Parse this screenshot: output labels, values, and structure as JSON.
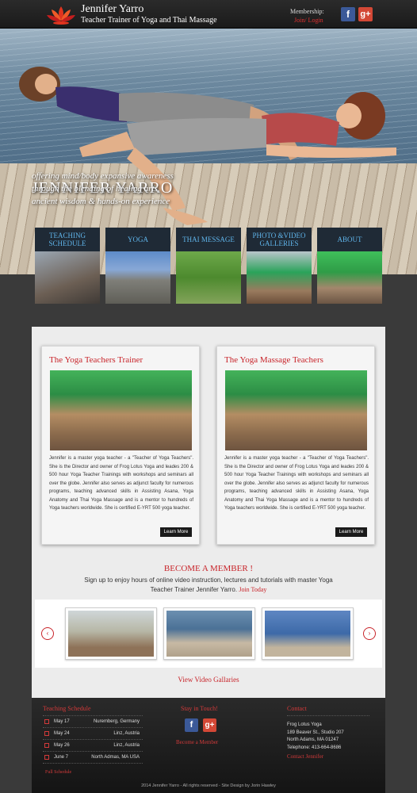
{
  "header": {
    "site_name": "Jennifer Yarro",
    "tagline": "Teacher Trainer  of Yoga and Thai Massage",
    "membership_label": "Membership:",
    "join_login": "Join/ Login",
    "social": {
      "facebook": "f",
      "google_plus": "g+"
    }
  },
  "hero": {
    "name": "JENNIFER YARRO",
    "lines": [
      "offering mind/body expansive awareness",
      "through the blending of healing arts,",
      "ancient wisdom & hands-on experience"
    ]
  },
  "nav": [
    {
      "label": "TEACHING SCHEDULE"
    },
    {
      "label": "YOGA"
    },
    {
      "label": "THAI MESSAGE"
    },
    {
      "label": "PHOTO &VIDEO GALLERIES"
    },
    {
      "label": "ABOUT"
    }
  ],
  "cards": [
    {
      "title": "The Yoga Teachers Trainer",
      "text": "Jennifer is a master yoga teacher - a \"Teacher of Yoga Teachers\". She is the Director and owner of Frog Lotus Yoga and leades 200 & 500 hour Yoga Teacher Trainings with workshops and seminars all over the globe. Jennifer also serves as adjunct faculty for numerous programs, teaching advanced skills in Assisting Asana, Yoga Anatomy and Thai Yoga Massage and is a mentor to hundreds of Yoga teachers worldwide. She is certified E-YRT 500 yoga teacher.",
      "button": "Learn More"
    },
    {
      "title": "The Yoga Massage Teachers",
      "text": "Jennifer is a master yoga teacher - a \"Teacher of Yoga Teachers\". She is the Director and owner of Frog Lotus Yoga and leades 200 & 500 hour Yoga Teacher Trainings with workshops and seminars all over the globe. Jennifer also serves as adjunct faculty for numerous programs, teaching advanced skills in Assisting Asana, Yoga Anatomy and Thai Yoga Massage and is a mentor to hundreds of Yoga teachers worldwide. She is certified E-YRT 500 yoga teacher.",
      "button": "Learn More"
    }
  ],
  "member": {
    "title": "BECOME A MEMBER !",
    "text": "Sign up to enjoy hours of online video instruction, lectures and tutorials with master Yoga Teacher Trainer Jennifer Yarro.",
    "join_today": "Join Today"
  },
  "carousel": {
    "prev_icon": "‹",
    "next_icon": "›"
  },
  "video_galleries": "View Video Gallaries",
  "footer": {
    "schedule_title": "Teaching Schedule",
    "schedule": [
      {
        "date": "May 17",
        "location": "Nuremberg, Germany"
      },
      {
        "date": "May 24",
        "location": "Linz, Austria"
      },
      {
        "date": "May 26",
        "location": "Linz, Austria"
      },
      {
        "date": "June 7",
        "location": "North Admas, MA USA"
      }
    ],
    "full_schedule": "Full Schedule",
    "stay_in_touch": "Stay in Touch!",
    "become_member": "Become a Member",
    "contact_title": "Contact",
    "address": [
      "Frog Lotus Yoga",
      "189 Beaver St., Studio 207",
      "North Adams, MA 01247",
      "Telephone: 413-664-8686"
    ],
    "contact_link": "Contact Jennifer",
    "copyright": "2014 Jennifer Yarro - All rights reserved - Site Design by Jorin Hawley"
  },
  "colors": {
    "accent_red": "#c8242a",
    "nav_blue": "#5fb4ea",
    "facebook": "#3b5998",
    "google": "#d34836"
  }
}
